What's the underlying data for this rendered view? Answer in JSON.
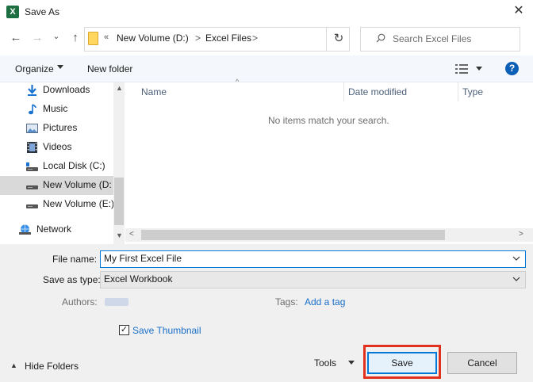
{
  "window": {
    "title": "Save As",
    "app_icon": "X",
    "close_glyph": "✕"
  },
  "nav": {
    "back_glyph": "←",
    "forward_glyph": "→",
    "recent_glyph": "⌄",
    "up_glyph": "↑",
    "address_prefix": "«",
    "breadcrumbs": [
      "New Volume (D:)",
      "Excel Files"
    ],
    "separator": ">",
    "refresh_glyph": "↻",
    "search_placeholder": "Search Excel Files"
  },
  "toolbar": {
    "organize": "Organize",
    "new_folder": "New folder",
    "help": "?"
  },
  "sidebar": {
    "items": [
      {
        "label": "Downloads",
        "icon": "download-icon"
      },
      {
        "label": "Music",
        "icon": "music-icon"
      },
      {
        "label": "Pictures",
        "icon": "pictures-icon"
      },
      {
        "label": "Videos",
        "icon": "videos-icon"
      },
      {
        "label": "Local Disk (C:)",
        "icon": "drive-icon"
      },
      {
        "label": "New Volume (D:",
        "icon": "drive-icon",
        "selected": true
      },
      {
        "label": "New Volume (E:)",
        "icon": "drive-icon"
      },
      {
        "label": "Network",
        "icon": "network-icon"
      }
    ]
  },
  "file_list": {
    "columns": [
      "Name",
      "Date modified",
      "Type"
    ],
    "empty_message": "No items match your search."
  },
  "form": {
    "file_name_label": "File name:",
    "file_name_value": "My First Excel File",
    "save_type_label": "Save as type:",
    "save_type_value": "Excel Workbook",
    "authors_label": "Authors:",
    "tags_label": "Tags:",
    "tags_link": "Add a tag",
    "save_thumbnail_label": "Save Thumbnail",
    "save_thumbnail_checked": true
  },
  "footer": {
    "hide_folders": "Hide Folders",
    "tools": "Tools",
    "save": "Save",
    "cancel": "Cancel"
  },
  "colors": {
    "accent": "#0078d7",
    "highlight": "#e0301e",
    "excel_green": "#1d6f42",
    "link": "#1a6ec8"
  }
}
